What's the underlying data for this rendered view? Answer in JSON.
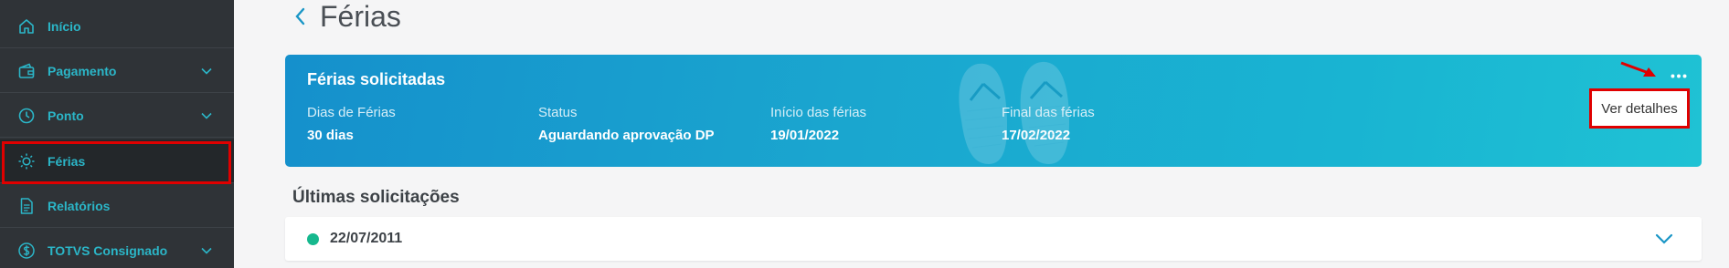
{
  "sidebar": {
    "items": [
      {
        "label": "Início",
        "icon": "home-icon",
        "has_chevron": false
      },
      {
        "label": "Pagamento",
        "icon": "wallet-icon",
        "has_chevron": true
      },
      {
        "label": "Ponto",
        "icon": "clock-icon",
        "has_chevron": true
      },
      {
        "label": "Férias",
        "icon": "sun-icon",
        "has_chevron": false,
        "active": true
      },
      {
        "label": "Relatórios",
        "icon": "document-icon",
        "has_chevron": false
      },
      {
        "label": "TOTVS Consignado",
        "icon": "dollar-icon",
        "has_chevron": true
      }
    ],
    "colors": {
      "background": "#2f3337",
      "label": "#2bb6c8",
      "highlight": "#e00000"
    }
  },
  "header": {
    "title": "Férias"
  },
  "card": {
    "title": "Férias solicitadas",
    "fields": [
      {
        "label": "Dias de Férias",
        "value": "30 dias"
      },
      {
        "label": "Status",
        "value": "Aguardando aprovação DP"
      },
      {
        "label": "Início das férias",
        "value": "19/01/2022"
      },
      {
        "label": "Final das férias",
        "value": "17/02/2022"
      }
    ],
    "menu_label": "Ver detalhes",
    "colors": {
      "gradient_start": "#1590cc",
      "gradient_end": "#1fc2d4"
    }
  },
  "requests": {
    "title": "Últimas solicitações",
    "items": [
      {
        "date": "22/07/2011",
        "status_color": "#16b88e"
      }
    ]
  }
}
